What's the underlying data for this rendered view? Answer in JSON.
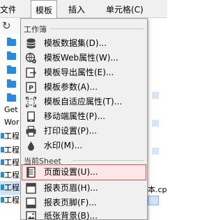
{
  "menubar": {
    "file": "文件",
    "template": "模板",
    "insert": "插入",
    "cell": "单元格(C)",
    "right_fragment": ""
  },
  "tree": {
    "items": [
      "Get",
      "Wor",
      "工程",
      "工程",
      "工程",
      "工程",
      "工程",
      "工程"
    ]
  },
  "background": {
    "right_text": "本.cp"
  },
  "menu": {
    "section_workbook": "工作簿",
    "section_current_sheet": "当前Sheet",
    "items": [
      {
        "label": "模板数据集(D)...",
        "icon": "database-icon"
      },
      {
        "label": "模板Web属性(W)...",
        "icon": "globe-gear-icon"
      },
      {
        "label": "模板导出属性(E)...",
        "icon": "export-icon"
      },
      {
        "label": "模板参数(A)...",
        "icon": "parameter-icon"
      },
      {
        "label": "模板自适应属性(T)...",
        "icon": "adaptive-icon"
      },
      {
        "label": "移动端属性(P)...",
        "icon": "mobile-icon"
      },
      {
        "label": "打印设置(P)...",
        "icon": "printer-icon"
      },
      {
        "label": "水印(M)...",
        "icon": "watermark-icon"
      },
      {
        "label": "页面设置(U)...",
        "icon": "page-setup-icon"
      },
      {
        "label": "报表页眉(H)...",
        "icon": "header-icon"
      },
      {
        "label": "报表页脚(F)...",
        "icon": "footer-icon"
      },
      {
        "label": "纸张背景(B)...",
        "icon": "background-icon"
      }
    ]
  },
  "colors": {
    "accent_blue": "#2a89d8",
    "highlight_border": "#d9534f"
  }
}
